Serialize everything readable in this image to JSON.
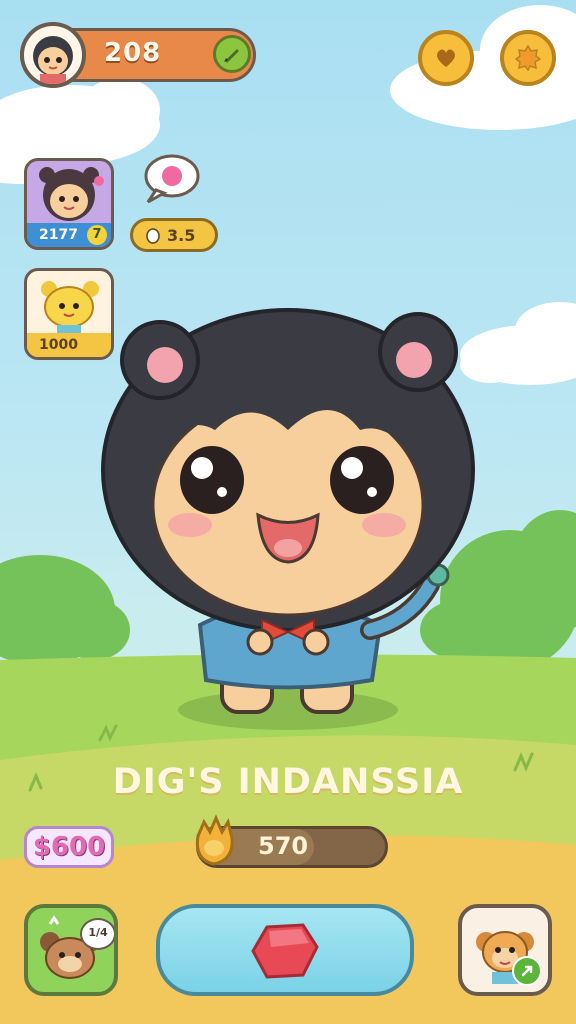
{
  "header": {
    "score": "208",
    "edit_icon": "pencil-icon",
    "heart_icon": "heart-icon",
    "settings_icon": "gear-icon"
  },
  "left_panel": {
    "cards": [
      {
        "name": "character-card-1",
        "value": "2177",
        "badge": "7"
      },
      {
        "name": "character-card-2",
        "value": "1000"
      }
    ],
    "speech_icon": "speech-bubble-icon",
    "resource_chip": {
      "icon": "egg-icon",
      "value": "3.5"
    }
  },
  "game_title": "DIG'S INDANSSIA",
  "bottom_stats": {
    "money": "$600",
    "progress_value": "570",
    "progress_fraction": 0.62,
    "progress_icon": "leaf-crown-icon"
  },
  "bottom_bar": {
    "left_button_badge": "1/4",
    "play_icon": "gem-icon",
    "right_button_icon": "arrow-icon"
  },
  "colors": {
    "sky": "#a9dff2",
    "grass": "#a6d65c",
    "accent_orange": "#e8894a",
    "accent_gold": "#f6be3a",
    "play_button": "#7bd2e6"
  }
}
